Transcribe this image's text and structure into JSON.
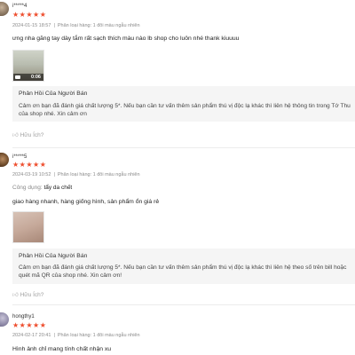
{
  "reviews": [
    {
      "username": "i*****4",
      "stars": "★★★★★",
      "date": "2024-01-15 18:57",
      "sep": "|",
      "variant": "Phân loại hàng: 1 đôi màu ngẫu nhiên",
      "comment": "ưng nha găng tay dày tắm rất sạch thích màu nào lb shop cho luôn nhé thank kiuuuu",
      "media_duration": "0:06",
      "seller_title": "Phản Hồi Của Người Bán",
      "seller_reply_1": "Cảm ơn bạn đã đánh giá chất lượng 5*. Nếu bạn cần tư vấn thêm sản phẩm thú vị độc lạ khác thì liên hệ thông tin trong Tớ Thu",
      "seller_reply_2": "của shop nhé. Xin cảm ơn",
      "helpful": "Hữu Ích?"
    },
    {
      "username": "i*****5",
      "stars": "★★★★★",
      "date": "2024-03-19 10:52",
      "sep": "|",
      "variant": "Phân loại hàng: 1 đôi màu ngẫu nhiên",
      "tag_label": "Công dụng:",
      "tag_value": "tẩy da chết",
      "comment": "giao hàng nhanh, hàng giống hình, sản phẩm ổn giá rẻ",
      "seller_title": "Phản Hồi Của Người Bán",
      "seller_reply_1": "Cảm ơn bạn đã đánh giá chất lượng 5*. Nếu bạn cần tư vấn thêm sản phẩm thú vị độc lạ khác thì liên hệ theo số trên bill hoặc",
      "seller_reply_2": "quét mã QR của shop nhé. Xin cảm ơn!",
      "helpful": "Hữu Ích?"
    },
    {
      "username": "hongthy1",
      "stars": "★★★★★",
      "date": "2024-02-17 20:41",
      "sep": "|",
      "variant": "Phân loại hàng: 1 đôi màu ngẫu nhiên",
      "comment": "Hình ảnh chỉ mang tính chất nhận xu"
    }
  ]
}
